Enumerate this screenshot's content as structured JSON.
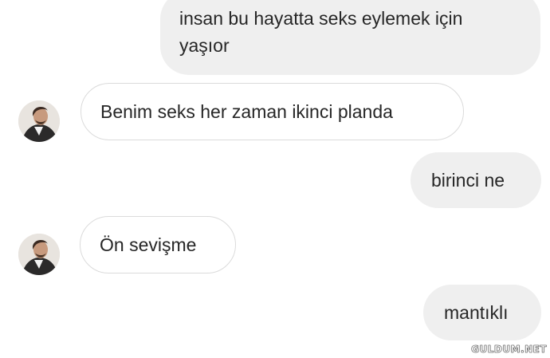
{
  "messages": [
    {
      "sender": "me",
      "text_line1": "insan bu hayatta seks eylemek için",
      "text_line2": "yaşıor"
    },
    {
      "sender": "other",
      "text": "Benim seks her zaman ikinci planda"
    },
    {
      "sender": "me",
      "text": "birinci ne"
    },
    {
      "sender": "other",
      "text": "Ön sevişme"
    },
    {
      "sender": "me",
      "text": "mantıklı"
    }
  ],
  "watermark": "GULDUM.NET",
  "colors": {
    "sent_bubble": "#efefef",
    "received_border": "#dbdbdb",
    "text": "#262626"
  }
}
